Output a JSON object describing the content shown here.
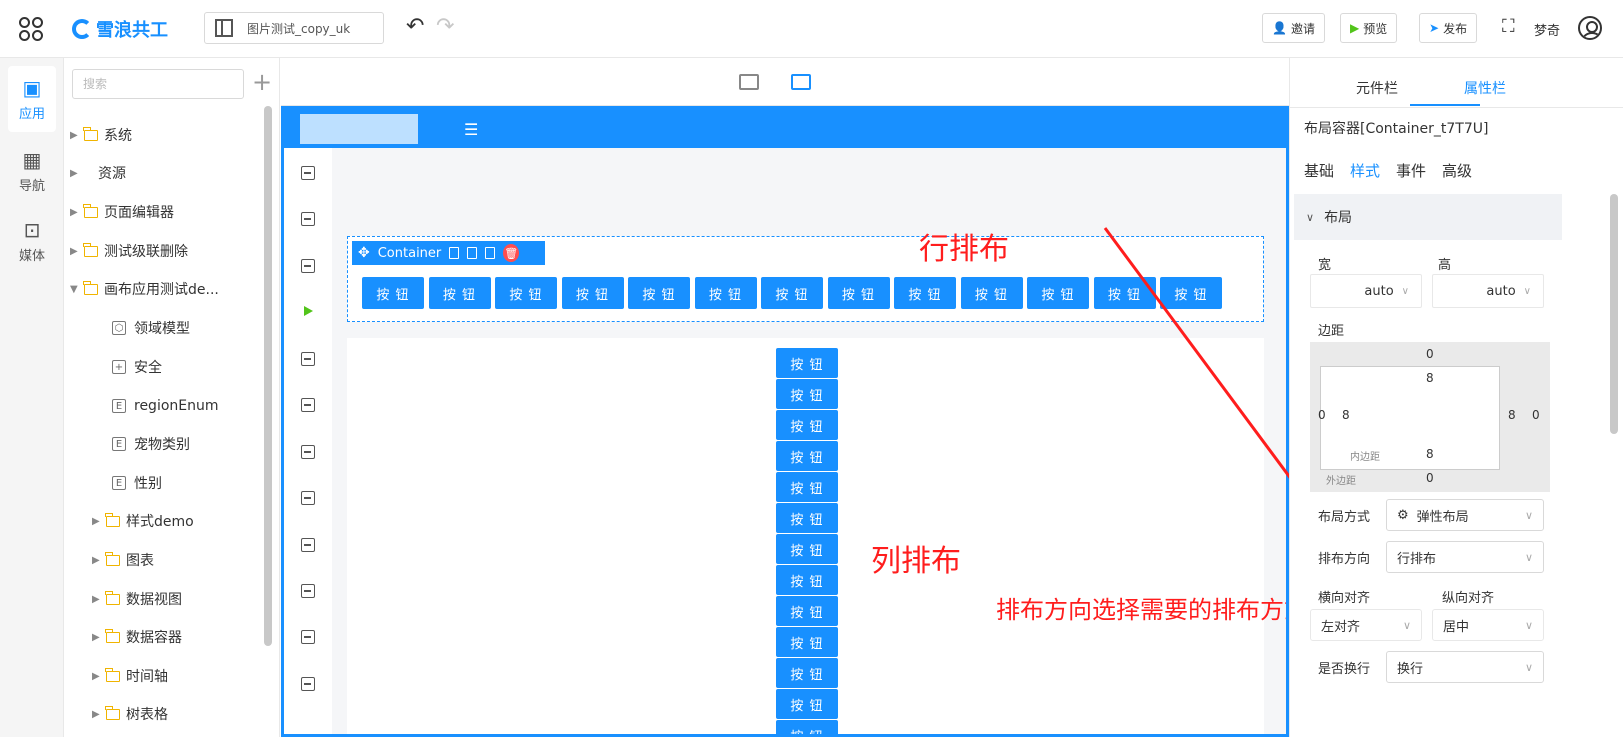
{
  "header": {
    "logo_text": "雪浪共工",
    "doc_name": "图片测试_copy_uk",
    "invite_label": "邀请",
    "preview_label": "预览",
    "publish_label": "发布",
    "user_name": "梦奇"
  },
  "rail": {
    "items": [
      {
        "label": "应用",
        "active": true
      },
      {
        "label": "导航"
      },
      {
        "label": "媒体"
      }
    ]
  },
  "tree": {
    "search_placeholder": "搜索",
    "items": [
      {
        "label": "系统"
      },
      {
        "label": "资源"
      },
      {
        "label": "页面编辑器"
      },
      {
        "label": "测试级联删除"
      },
      {
        "label": "画布应用测试de..."
      },
      {
        "label": "领域模型"
      },
      {
        "label": "安全"
      },
      {
        "label": "regionEnum"
      },
      {
        "label": "宠物类别"
      },
      {
        "label": "性别"
      },
      {
        "label": "样式demo"
      },
      {
        "label": "图表"
      },
      {
        "label": "数据视图"
      },
      {
        "label": "数据容器"
      },
      {
        "label": "时间轴"
      },
      {
        "label": "树表格"
      }
    ]
  },
  "canvas": {
    "container_label": "Container",
    "button_label": "按 钮",
    "row_button_count": 13,
    "col_button_count": 13,
    "annotations": {
      "row": "行排布",
      "col": "列排布",
      "hint": "排布方向选择需要的排布方式"
    }
  },
  "inspector": {
    "tabs": [
      "元件栏",
      "属性栏"
    ],
    "component_title": "布局容器[Container_t7T7U]",
    "subtabs": [
      "基础",
      "样式",
      "事件",
      "高级"
    ],
    "section_title": "布局",
    "width_label": "宽",
    "height_label": "高",
    "width_value": "auto",
    "height_value": "auto",
    "margin_label": "边距",
    "margin_outer_top": "0",
    "margin_inner_top": "8",
    "margin_left_outer": "0",
    "margin_left_inner": "8",
    "margin_right_inner": "8",
    "margin_right_outer": "0",
    "margin_inner_bottom": "8",
    "margin_outer_bottom": "0",
    "padding_caption": "内边距",
    "margin_caption": "外边距",
    "layout_mode_label": "布局方式",
    "layout_mode_value": "弹性布局",
    "direction_label": "排布方向",
    "direction_value": "行排布",
    "h_align_label": "横向对齐",
    "v_align_label": "纵向对齐",
    "h_align_value": "左对齐",
    "v_align_value": "居中",
    "wrap_label": "是否换行",
    "wrap_value": "换行"
  }
}
